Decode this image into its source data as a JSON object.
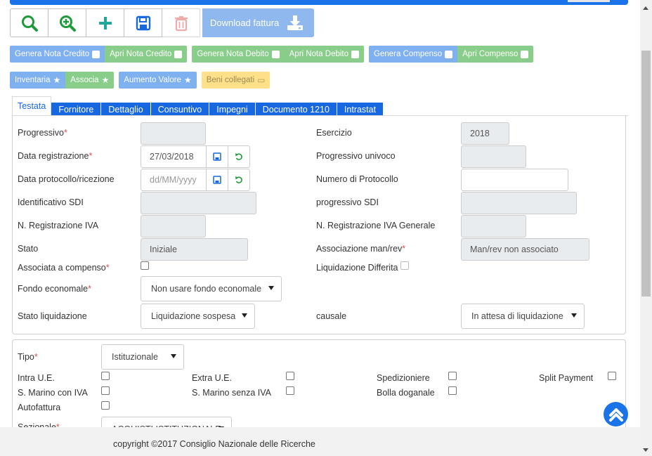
{
  "toolbar": {
    "download_label": "Download fattura"
  },
  "buttons_row1": [
    {
      "label": "Genera Nota Credito",
      "style": "blue"
    },
    {
      "label": "Apri Nota Credito",
      "style": "green"
    },
    {
      "label": "Genera Nota Debito",
      "style": "green"
    },
    {
      "label": "Apri Nota Debito",
      "style": "green"
    },
    {
      "label": "Genera Compenso",
      "style": "blue"
    },
    {
      "label": "Apri Compenso",
      "style": "green"
    }
  ],
  "buttons_row2": {
    "inventaria": "Inventaria",
    "associa": "Associa",
    "aumento_valore": "Aumento Valore",
    "beni_collegati": "Beni collegati"
  },
  "tabs": [
    "Testata",
    "Fornitore",
    "Dettaglio",
    "Consuntivo",
    "Impegni",
    "Documento 1210",
    "Intrastat"
  ],
  "form": {
    "progressivo": {
      "label": "Progressivo",
      "value": ""
    },
    "esercizio": {
      "label": "Esercizio",
      "value": "2018"
    },
    "data_registrazione": {
      "label": "Data registrazione",
      "value": "27/03/2018"
    },
    "progressivo_univoco": {
      "label": "Progressivo univoco",
      "value": ""
    },
    "data_protocollo": {
      "label": "Data protocollo/ricezione",
      "placeholder": "dd/MM/yyyy"
    },
    "numero_protocollo": {
      "label": "Numero di Protocollo",
      "value": ""
    },
    "identificativo_sdi": {
      "label": "Identificativo SDI",
      "value": ""
    },
    "progressivo_sdi": {
      "label": "progressivo SDI",
      "value": ""
    },
    "n_registrazione_iva": {
      "label": "N. Registrazione IVA",
      "value": ""
    },
    "n_registrazione_iva_generale": {
      "label": "N. Registrazione IVA Generale",
      "value": ""
    },
    "stato": {
      "label": "Stato",
      "value": "Iniziale"
    },
    "associazione": {
      "label": "Associazione man/rev",
      "value": "Man/rev non associato"
    },
    "associata_compenso": {
      "label": "Associata a compenso",
      "checked": false
    },
    "liquidazione_differita": {
      "label": "Liquidazione Differita",
      "checked": false
    },
    "fondo_economale": {
      "label": "Fondo economale",
      "value": "Non usare fondo economale"
    },
    "stato_liquidazione": {
      "label": "Stato liquidazione",
      "value": "Liquidazione sospesa"
    },
    "causale": {
      "label": "causale",
      "value": "In attesa di liquidazione"
    }
  },
  "form2": {
    "tipo": {
      "label": "Tipo",
      "value": "Istituzionale"
    },
    "intra_ue": "Intra U.E.",
    "extra_ue": "Extra U.E.",
    "spedizioniere": "Spedizioniere",
    "split_payment": "Split Payment",
    "s_marino_iva": "S. Marino con IVA",
    "s_marino_senza_iva": "S. Marino senza IVA",
    "bolla_doganale": "Bolla doganale",
    "autofattura": "Autofattura",
    "sezionale": {
      "label": "Sezionale",
      "value": "ACQUISTI ISTITUZIONALE"
    }
  },
  "footer": {
    "copyright": "copyright ©2017 Consiglio Nazionale delle Ricerche"
  },
  "colors": {
    "primary": "#1a73e8",
    "tab": "#1767e0",
    "btn_blue": "#7fb0f0",
    "btn_green": "#88cd8a",
    "btn_yellow": "#ffe08a",
    "required": "#d9534f"
  }
}
